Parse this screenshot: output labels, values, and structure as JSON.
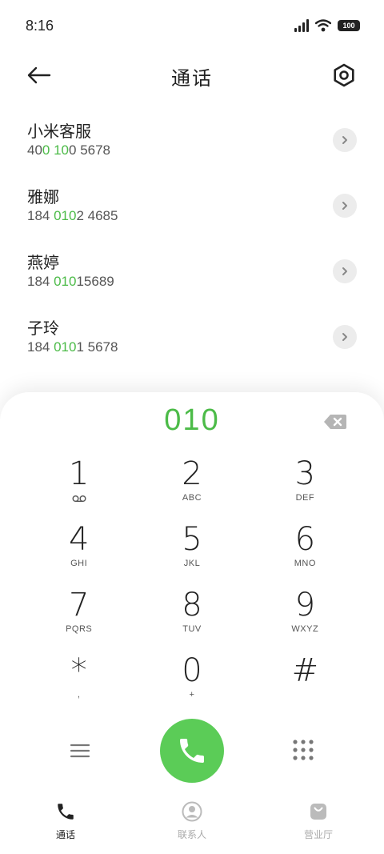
{
  "status_bar": {
    "time": "8:16",
    "battery": "100"
  },
  "header": {
    "title": "通话"
  },
  "contacts": [
    {
      "name": "小米客服",
      "number_pre": "40",
      "number_hl": "0 10",
      "number_post": "0 5678"
    },
    {
      "name": "雅娜",
      "number_pre": "184 ",
      "number_hl": "010",
      "number_post": "2 4685"
    },
    {
      "name": "燕婷",
      "number_pre": "184 ",
      "number_hl": "010",
      "number_post": "15689"
    },
    {
      "name": "子玲",
      "number_pre": "184 ",
      "number_hl": "010",
      "number_post": "1 5678"
    }
  ],
  "dialer": {
    "input": "010",
    "keys": [
      {
        "digit": "1",
        "letters": ""
      },
      {
        "digit": "2",
        "letters": "ABC"
      },
      {
        "digit": "3",
        "letters": "DEF"
      },
      {
        "digit": "4",
        "letters": "GHI"
      },
      {
        "digit": "5",
        "letters": "JKL"
      },
      {
        "digit": "6",
        "letters": "MNO"
      },
      {
        "digit": "7",
        "letters": "PQRS"
      },
      {
        "digit": "8",
        "letters": "TUV"
      },
      {
        "digit": "9",
        "letters": "WXYZ"
      },
      {
        "digit": "*",
        "letters": ","
      },
      {
        "digit": "0",
        "letters": "+"
      },
      {
        "digit": "#",
        "letters": ""
      }
    ]
  },
  "tabs": [
    {
      "label": "通话",
      "icon": "phone-icon"
    },
    {
      "label": "联系人",
      "icon": "person-icon"
    },
    {
      "label": "营业厅",
      "icon": "bag-icon"
    }
  ],
  "colors": {
    "accent": "#4cbb48",
    "call_button": "#5bcc57"
  }
}
